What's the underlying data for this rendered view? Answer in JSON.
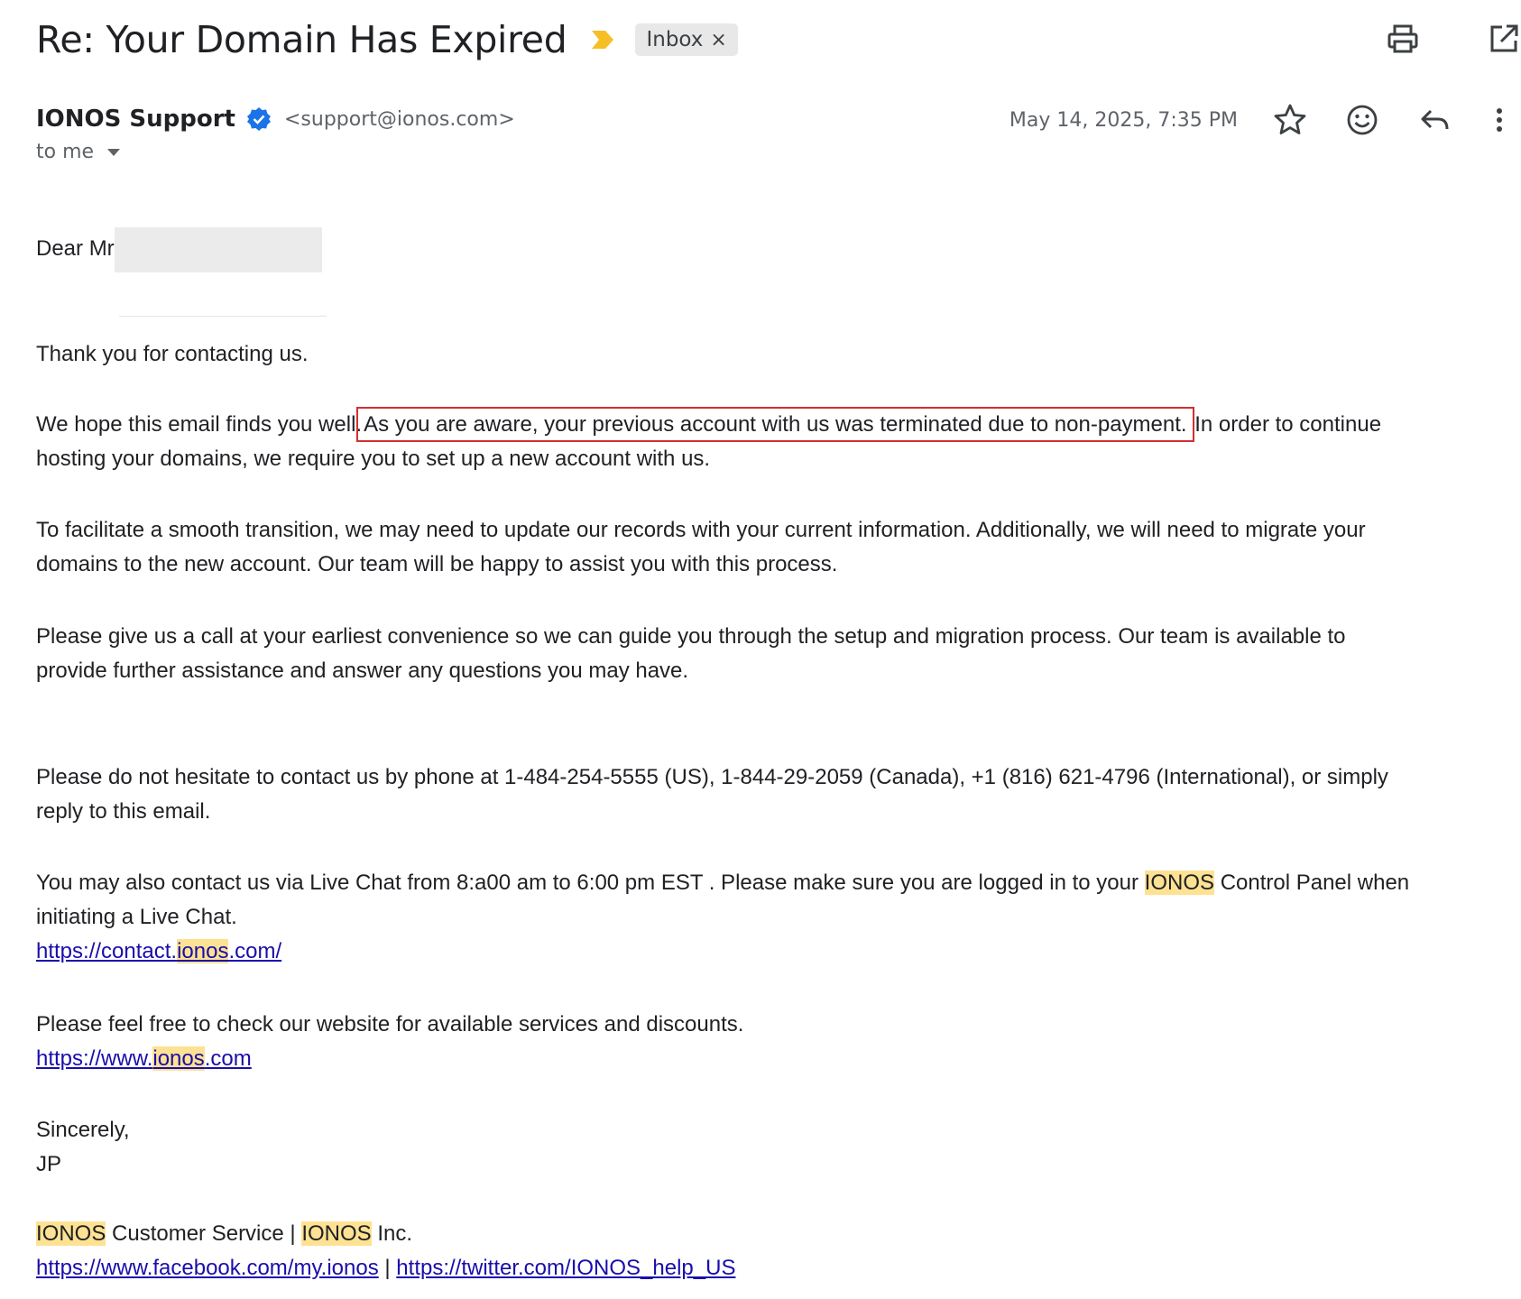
{
  "email": {
    "subject": "Re: Your Domain Has Expired",
    "label": "Inbox",
    "label_close": "×",
    "sender_name": "IONOS Support",
    "sender_email": "<support@ionos.com>",
    "recipient": "to me",
    "date": "May 14, 2025, 7:35 PM"
  },
  "icons": {
    "importance": "importance-marker-icon",
    "print": "print-icon",
    "open_new": "open-in-new-window-icon",
    "verified": "verified-badge-icon",
    "star": "star-icon",
    "emoji": "emoji-reaction-icon",
    "reply": "reply-icon",
    "more": "more-vertical-icon"
  },
  "colors": {
    "importance": "#f6bf26",
    "verified": "#1a73e8",
    "highlight": "#fde293",
    "annotation_box": "#d32f2f",
    "link": "#1a0dab"
  },
  "body": {
    "greeting": "Dear Mr",
    "thanks": "Thank you for contacting us.",
    "p1_start": "We hope this email finds you well.",
    "p1_boxed": "As you are aware, your previous account with us was terminated due to non-payment.",
    "p1_end": "In order to continue",
    "p1_line2": "hosting your domains, we require you to set up a new account with us.",
    "p2_line1": "To facilitate a smooth transition, we may need to update our records with your current information. Additionally, we will need to migrate your",
    "p2_line2": "domains to the new account. Our team will be happy to assist you with this process.",
    "p3_line1": "Please give us a call at your earliest convenience so we can guide you through the setup and migration process. Our team is available to",
    "p3_line2": "provide further assistance and answer any questions you may have.",
    "p4_line1": "Please do not hesitate to contact us by phone at 1-484-254-5555 (US), 1-844-29-2059 (Canada), +1 (816) 621-4796 (International), or simply",
    "p4_line2": "reply to this email.",
    "p5_start": "You may also contact us via Live Chat from 8:a00 am to 6:00 pm EST . Please make sure you are logged in to your",
    "p5_brand": "IONOS",
    "p5_end": "Control Panel when",
    "p5_line2": "initiating a Live Chat.",
    "link1_pre": "https://contact.",
    "link1_hl": "ionos",
    "link1_post": ".com/",
    "p6": "Please feel free to check our website for available services and discounts.",
    "link2_pre": "https://www.",
    "link2_hl": "ionos",
    "link2_post": ".com",
    "signoff": "Sincerely,",
    "signer": "JP",
    "sig_brand1": "IONOS",
    "sig_mid": "Customer Service |",
    "sig_brand2": "IONOS",
    "sig_end": "Inc.",
    "link3": "https://www.facebook.com/my.ionos",
    "link_sep": "|",
    "link4": "https://twitter.com/IONOS_help_US"
  }
}
